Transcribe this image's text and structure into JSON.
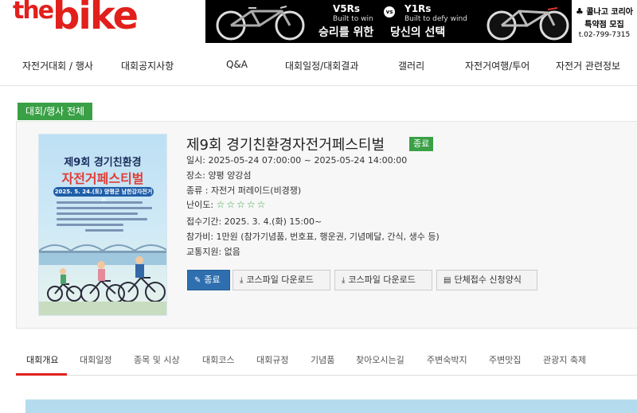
{
  "header": {
    "logo_the": "the",
    "logo_bike": "bike",
    "banner": {
      "model1": "V5Rs",
      "tag1": "Built to win",
      "main1": "승리를 위한",
      "vs": "vs",
      "model2": "Y1Rs",
      "tag2": "Built to defy wind",
      "main2": "당신의 선택",
      "side_line1_icon": "♣",
      "side_line1": "콜나고 코리아",
      "side_line2": "특약점 모집",
      "side_line3": "t.02-799-7315"
    }
  },
  "nav": {
    "items": [
      "자전거대회 / 행사",
      "대회공지사항",
      "Q&A",
      "대회일정/대회결과",
      "갤러리",
      "자전거여행/투어",
      "자전거 관련정보"
    ]
  },
  "category_tag": "대회/행사 전체",
  "poster": {
    "title1": "제9회 경기친환경",
    "title2": "자전거페스티벌",
    "date": "2025. 5. 24.(토) 양평군 남한강자전거길"
  },
  "event": {
    "title": "제9회 경기친환경자전거페스티벌",
    "status": "종료",
    "date_label": "일시: 2025-05-24 07:00:00 ~ 2025-05-24 14:00:00",
    "place_label": "장소: 양평 양강섬",
    "type_label": "종류 : 자전거 퍼레이드(비경쟁)",
    "difficulty_label": "난이도:",
    "difficulty_stars": "☆☆☆☆☆",
    "registration_label": "접수기간: 2025. 3. 4.(화) 15:00~",
    "fee_label": "참가비: 1만원 (참가기념품, 번호표, 행운권, 기념메달, 간식, 생수 등)",
    "transport_label": "교통지원: 없음"
  },
  "buttons": {
    "status": "종료",
    "course1": "코스파일 다운로드",
    "course2": "코스파일 다운로드",
    "group": "단체접수 신청양식"
  },
  "tabs": [
    "대회개요",
    "대회일정",
    "종목 및 시상",
    "대회코스",
    "대회규정",
    "기념품",
    "찾아오시는길",
    "주변숙박지",
    "주변맛집",
    "관광지 축제"
  ],
  "colors": {
    "brand_red": "#e1201c",
    "accent_green": "#3aa046",
    "primary_blue": "#2f6faf"
  }
}
